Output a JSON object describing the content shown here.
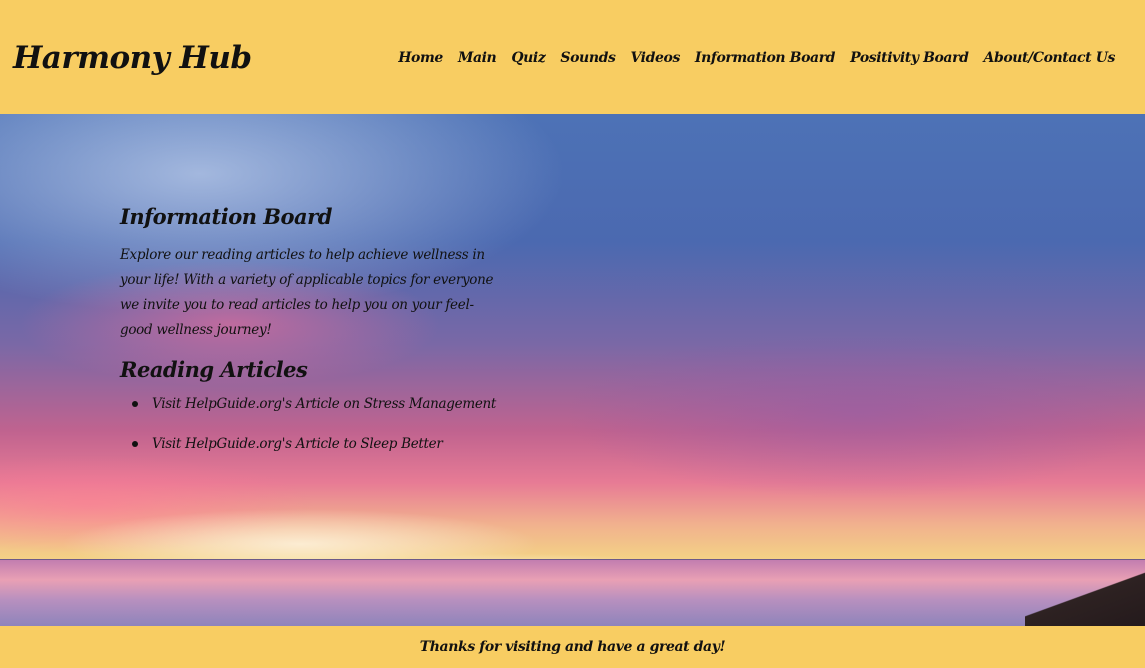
{
  "header": {
    "brand": "Harmony Hub",
    "nav": [
      "Home",
      "Main",
      "Quiz",
      "Sounds",
      "Videos",
      "Information Board",
      "Positivity Board",
      "About/Contact Us"
    ]
  },
  "main": {
    "title": "Information Board",
    "intro": "Explore our reading articles to help achieve wellness in your life! With a variety of applicable topics for everyone we invite you to read articles to help you on your feel-good wellness journey!",
    "articles_heading": "Reading Articles",
    "articles": [
      "Visit HelpGuide.org's Article on Stress Management",
      "Visit HelpGuide.org's Article to Sleep Better"
    ]
  },
  "footer": {
    "text": "Thanks for visiting and have a great day!"
  },
  "colors": {
    "header_bg": "#f8cd62",
    "footer_bg": "#f8cd62",
    "text": "#111111"
  }
}
